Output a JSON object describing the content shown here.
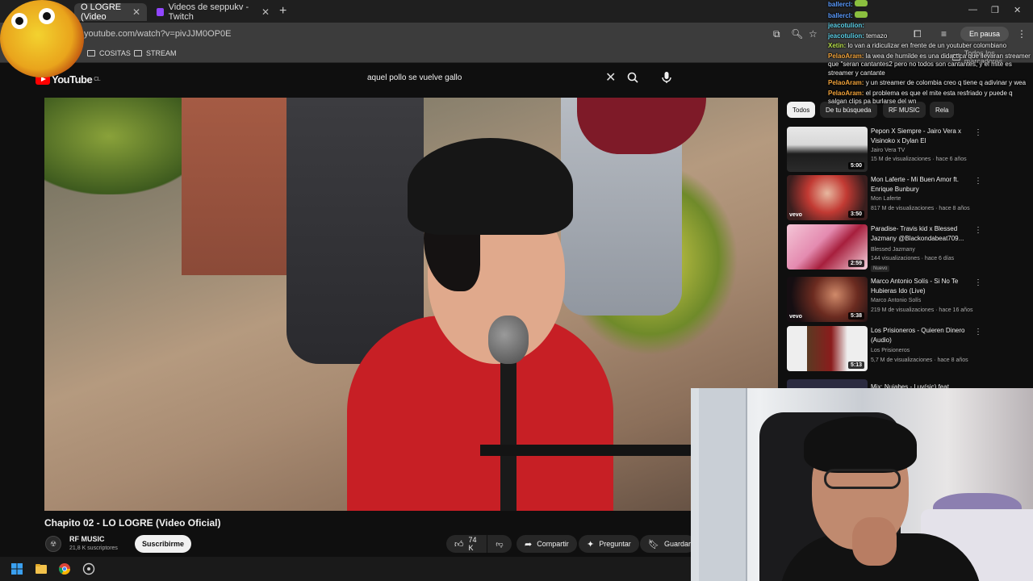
{
  "browser": {
    "tabs": [
      {
        "label": "O LOGRE (Video"
      },
      {
        "label": "Videos de seppukv - Twitch"
      }
    ],
    "url": "youtube.com/watch?v=pivJJM0OP0E",
    "pause_label": "En pausa",
    "bookmarks": [
      {
        "label": "COSITAS"
      },
      {
        "label": "STREAM"
      }
    ],
    "bookmarks_right": "Todos los marcadores"
  },
  "youtube": {
    "logo_text": "YouTube",
    "region": "CL",
    "search_value": "aquel pollo se vuelve gallo",
    "video": {
      "title": "Chapito 02 - LO LOGRE (Video Oficial)",
      "channel": "RF MUSIC",
      "subscribers": "21,8 K suscriptores",
      "subscribe_label": "Suscribirme",
      "likes": "74 K",
      "share_label": "Compartir",
      "ask_label": "Preguntar",
      "save_label": "Guardar"
    },
    "chips": [
      {
        "label": "Todos"
      },
      {
        "label": "De tu búsqueda"
      },
      {
        "label": "RF MUSIC"
      },
      {
        "label": "Rela"
      }
    ],
    "recommendations": [
      {
        "title": "Pepon X Siempre - Jairo Vera x Visinoko x Dylan El",
        "channel": "Jairo Vera TV",
        "meta": "15 M de visualizaciones · hace 6 años",
        "duration": "5:00"
      },
      {
        "title": "Mon Laferte - Mi Buen Amor ft. Enrique Bunbury",
        "channel": "Mon Laferte",
        "meta": "817 M de visualizaciones · hace 8 años",
        "duration": "3:50"
      },
      {
        "title": "Paradise- Travis kid x Blessed Jazmany @Blackondabeat709...",
        "channel": "Blessed Jazmany",
        "meta": "144 visualizaciones · hace 6 días",
        "duration": "2:59",
        "badge": "Nuevo"
      },
      {
        "title": "Marco Antonio Solís - Si No Te Hubieras Ido (Live)",
        "channel": "Marco Antonio Solís",
        "meta": "219 M de visualizaciones · hace 16 años",
        "duration": "5:38"
      },
      {
        "title": "Los Prisioneros - Quieren Dinero (Audio)",
        "channel": "Los Prisioneros",
        "meta": "5,7 M de visualizaciones · hace 8 años",
        "duration": "5:13"
      },
      {
        "title": "Mix: Nuiabes - Luv(sic) feat...",
        "channel": "",
        "meta": "",
        "duration": ""
      }
    ]
  },
  "chat": [
    {
      "user": "ballercl:",
      "text": ""
    },
    {
      "user": "ballercl:",
      "text": ""
    },
    {
      "user": "jeacotulion:",
      "text": ""
    },
    {
      "user": "jeacotulion:",
      "text": "temazo"
    },
    {
      "user": "Xetin:",
      "text": "lo van a ridiculizar en frente de un youtuber colombiano"
    },
    {
      "user": "PelaoAram:",
      "text": "la wea de humilde es una didactica que llevaran streamer que \"seran cantantes2 pero no todos son cantantes, y el mite es streamer y cantante"
    },
    {
      "user": "PelaoAram:",
      "text": "y un streamer de colombia creo q tiene q adivinar y wea"
    },
    {
      "user": "PelaoAram:",
      "text": "el problema es que el mite esta resfriado y puede q salgan clips pa burlarse del wn"
    }
  ]
}
